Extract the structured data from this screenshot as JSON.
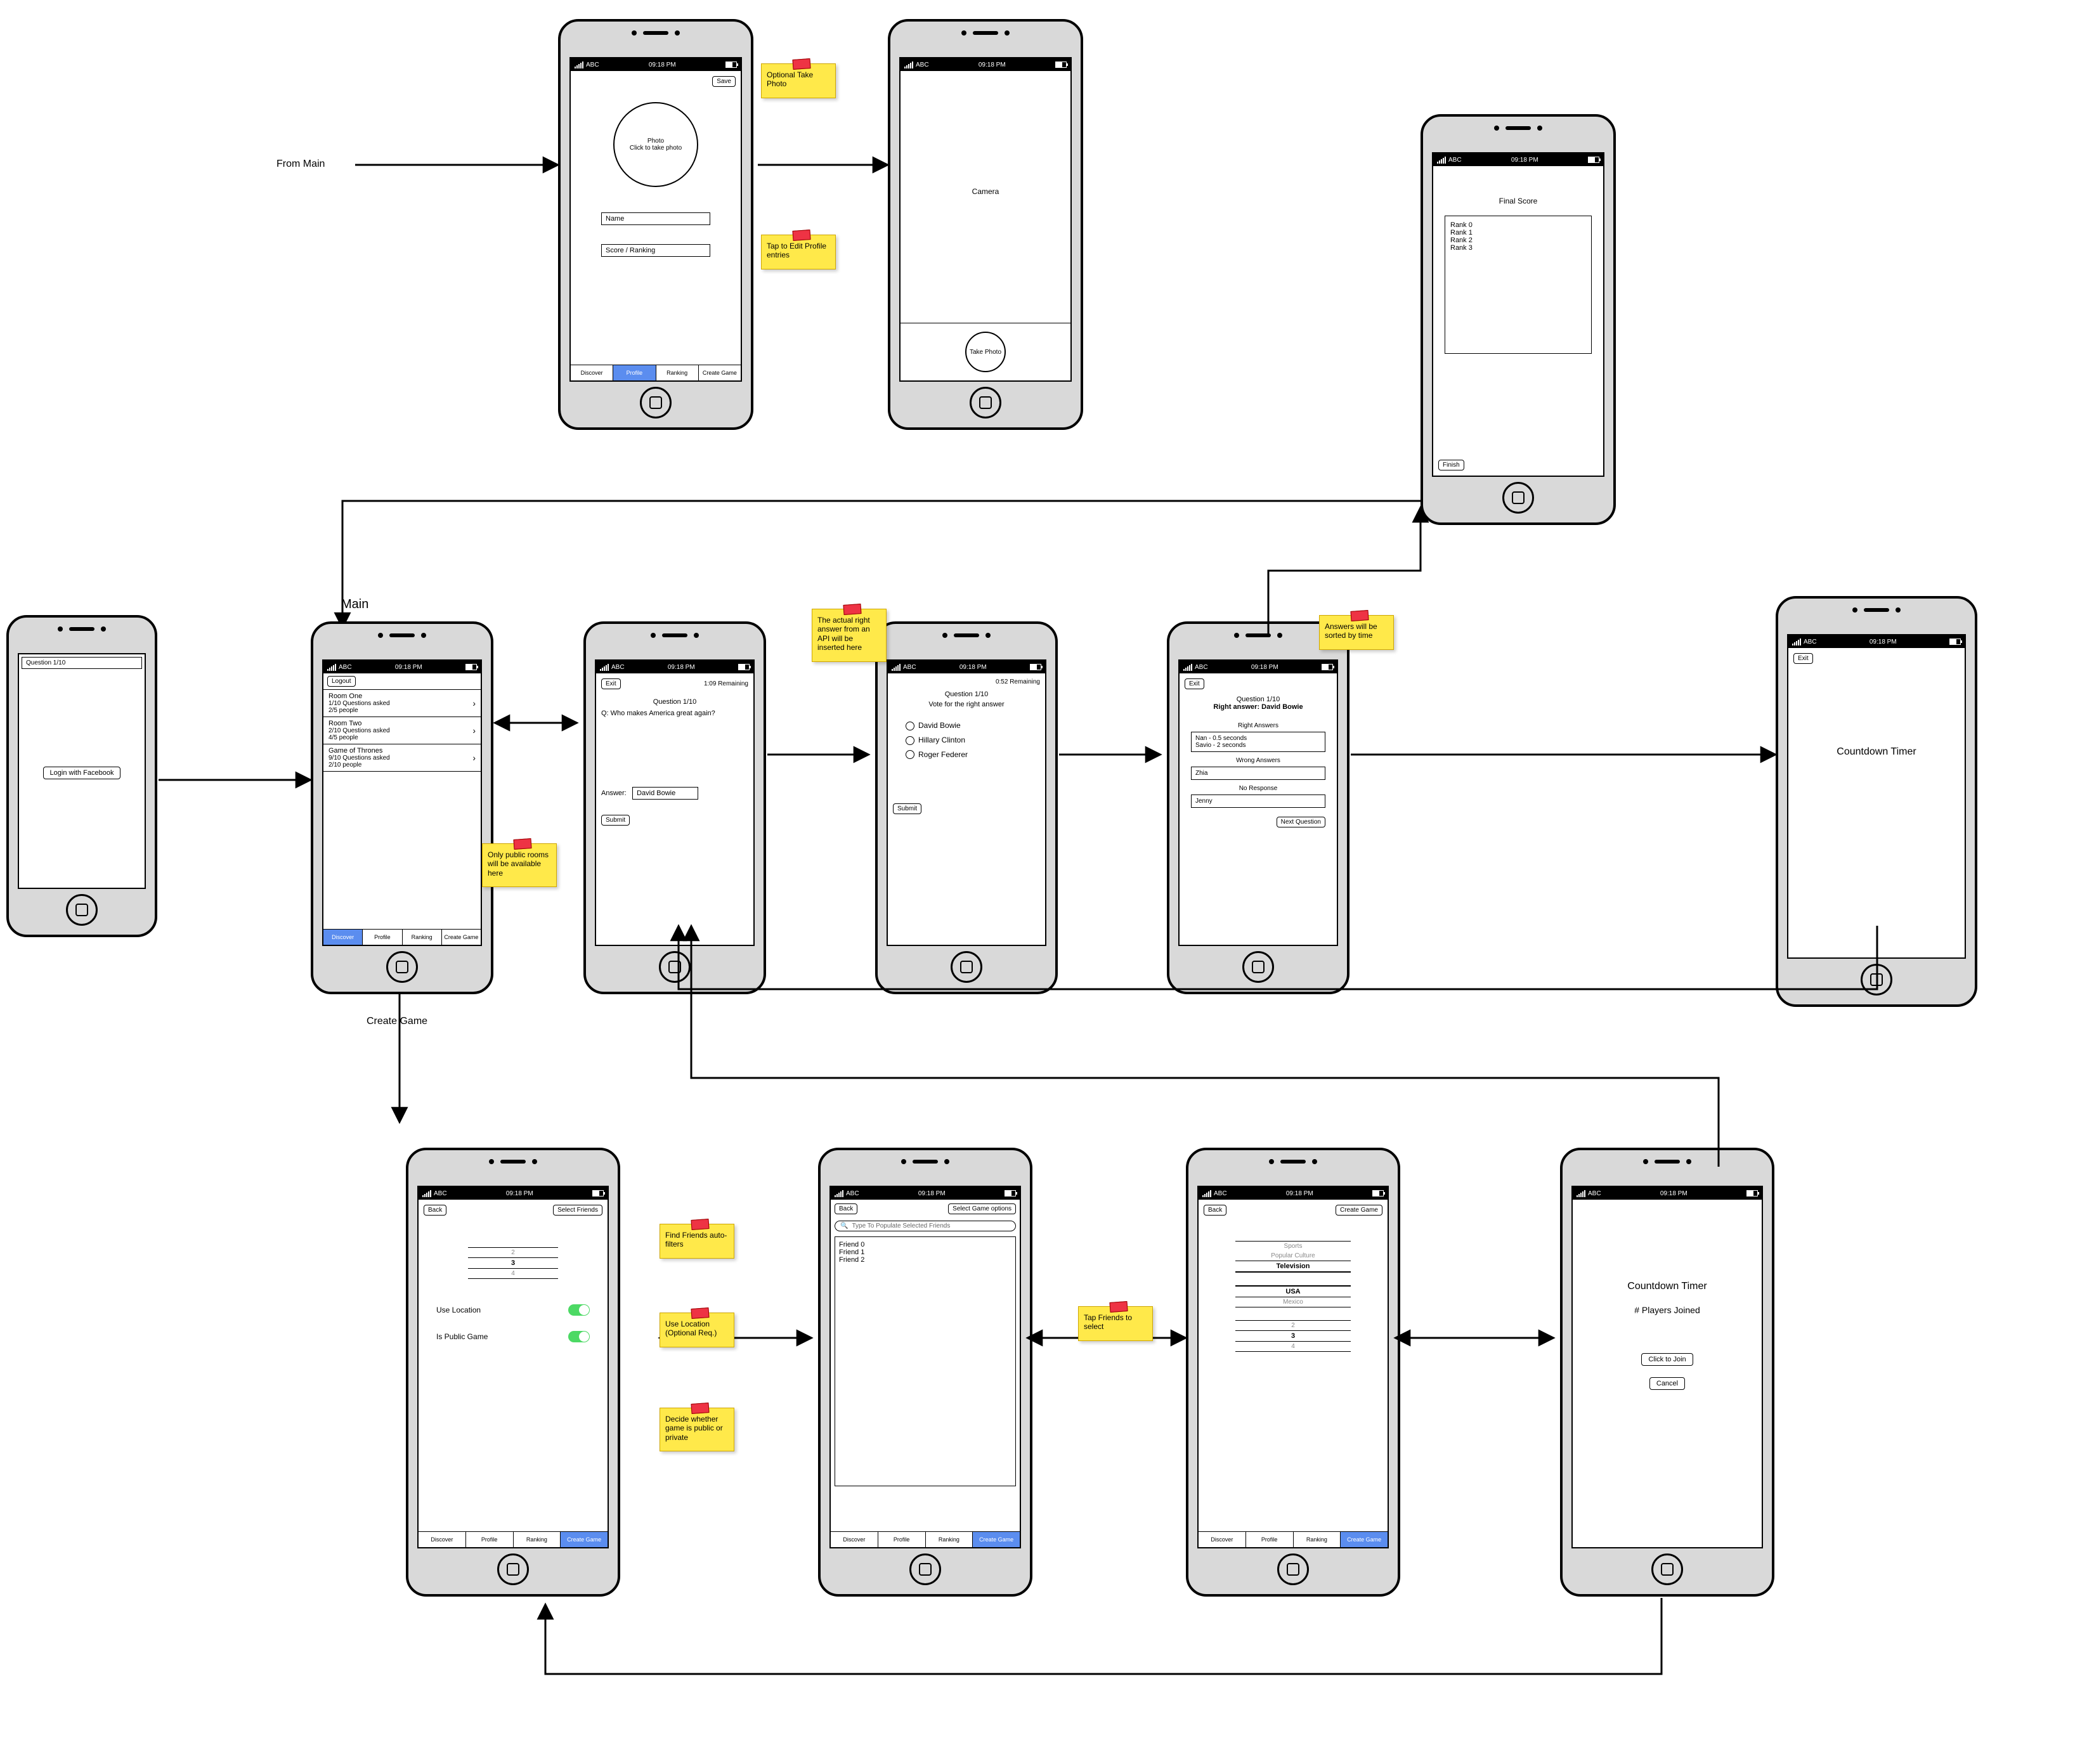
{
  "status": {
    "carrier": "ABC",
    "time": "09:18 PM"
  },
  "tabs": {
    "discover": "Discover",
    "profile": "Profile",
    "ranking": "Ranking",
    "create": "Create Game"
  },
  "labels": {
    "from_main": "From Main",
    "main": "Main",
    "create_game": "Create Game"
  },
  "notes": {
    "opt_photo": "Optional Take Photo",
    "edit_profile": "Tap to Edit Profile entries",
    "public_rooms": "Only public rooms will be available here",
    "api_answer": "The actual right answer from an API will be inserted here",
    "sorted": "Answers will be sorted by time",
    "find_friends": "Find Friends auto-filters",
    "use_loc": "Use Location (Optional Req.)",
    "decide": "Decide whether game is public or private",
    "tap_friends": "Tap Friends to select"
  },
  "login": {
    "header": "Question 1/10",
    "button": "Login with Facebook"
  },
  "profile": {
    "save": "Save",
    "photo_line1": "Photo",
    "photo_line2": "Click to take photo",
    "name": "Name",
    "score": "Score / Ranking"
  },
  "camera": {
    "title": "Camera",
    "take": "Take Photo"
  },
  "finalscore": {
    "title": "Final Score",
    "ranks": [
      "Rank 0",
      "Rank 1",
      "Rank 2",
      "Rank 3"
    ],
    "finish": "Finish"
  },
  "main": {
    "logout": "Logout",
    "rooms": [
      {
        "name": "Room One",
        "line1": "1/10 Questions asked",
        "line2": "2/5 people"
      },
      {
        "name": "Room Two",
        "line1": "2/10 Questions asked",
        "line2": "4/5 people"
      },
      {
        "name": "Game of Thrones",
        "line1": "9/10 Questions asked",
        "line2": "2/10 people"
      }
    ]
  },
  "question": {
    "exit": "Exit",
    "remaining": "1:09 Remaining",
    "title": "Question 1/10",
    "q": "Q: Who makes America great again?",
    "ans_label": "Answer:",
    "ans_value": "David Bowie",
    "submit": "Submit"
  },
  "vote": {
    "remaining": "0:52 Remaining",
    "title": "Question 1/10",
    "prompt": "Vote for the right answer",
    "opts": [
      "David Bowie",
      "Hillary Clinton",
      "Roger Federer"
    ],
    "submit": "Submit"
  },
  "results": {
    "exit": "Exit",
    "title": "Question 1/10",
    "right": "Right answer: David Bowie",
    "right_h": "Right Answers",
    "right_list": [
      "Nan - 0.5 seconds",
      "Savio - 2 seconds"
    ],
    "wrong_h": "Wrong Answers",
    "wrong_list": [
      "Zhia"
    ],
    "noresp_h": "No Response",
    "noresp_list": [
      "Jenny"
    ],
    "next": "Next Question"
  },
  "countdown1": {
    "exit": "Exit",
    "title": "Countdown Timer"
  },
  "creategame": {
    "back": "Back",
    "select_friends": "Select Friends",
    "picker": [
      "2",
      "3",
      "4"
    ],
    "use_location": "Use Location",
    "is_public": "Is Public Game"
  },
  "friends": {
    "back": "Back",
    "select_opts": "Select Game options",
    "search": "Type To Populate Selected Friends",
    "list": [
      "Friend 0",
      "Friend 1",
      "Friend 2"
    ]
  },
  "gameopts": {
    "back": "Back",
    "create": "Create Game",
    "topic_picker": [
      "Sports",
      "Popular Culture",
      "Television"
    ],
    "region_picker": [
      "USA",
      "Mexico"
    ],
    "num_picker": [
      "2",
      "3",
      "4"
    ]
  },
  "lobby": {
    "title": "Countdown Timer",
    "sub": "# Players Joined",
    "join": "Click to Join",
    "cancel": "Cancel"
  }
}
